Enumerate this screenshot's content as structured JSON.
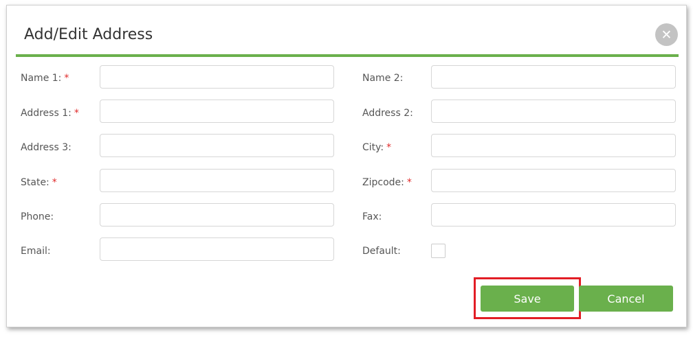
{
  "dialog": {
    "title": "Add/Edit Address",
    "close_icon": "close-icon",
    "accent_color": "#6ab04c",
    "required_marker": "*"
  },
  "form": {
    "name1": {
      "label": "Name 1:",
      "required": true,
      "value": ""
    },
    "name2": {
      "label": "Name 2:",
      "required": false,
      "value": ""
    },
    "address1": {
      "label": "Address 1:",
      "required": true,
      "value": ""
    },
    "address2": {
      "label": "Address 2:",
      "required": false,
      "value": ""
    },
    "address3": {
      "label": "Address 3:",
      "required": false,
      "value": ""
    },
    "city": {
      "label": "City:",
      "required": true,
      "value": ""
    },
    "state": {
      "label": "State:",
      "required": true,
      "value": ""
    },
    "zipcode": {
      "label": "Zipcode:",
      "required": true,
      "value": ""
    },
    "phone": {
      "label": "Phone:",
      "required": false,
      "value": ""
    },
    "fax": {
      "label": "Fax:",
      "required": false,
      "value": ""
    },
    "email": {
      "label": "Email:",
      "required": false,
      "value": ""
    },
    "default": {
      "label": "Default:",
      "checked": false
    }
  },
  "actions": {
    "save_label": "Save",
    "cancel_label": "Cancel",
    "highlight_color": "#e21d25"
  }
}
